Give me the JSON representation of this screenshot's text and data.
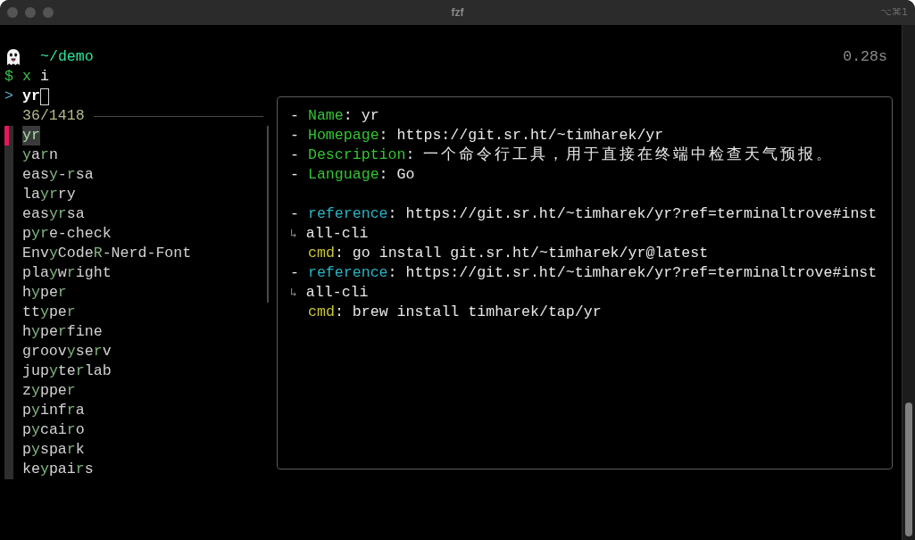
{
  "window": {
    "title": "fzf",
    "shortcut": "⌥⌘1"
  },
  "prompt": {
    "cwd": "~/demo",
    "elapsed": "0.28s"
  },
  "command": {
    "symbol": "$",
    "program": "x",
    "args": "i"
  },
  "query": {
    "marker": ">",
    "value": "yr"
  },
  "counter": "36/1418",
  "results": [
    {
      "selected": true,
      "parts": [
        {
          "text": "yr",
          "match": true
        }
      ]
    },
    {
      "selected": false,
      "parts": [
        {
          "text": "y",
          "match": true
        },
        {
          "text": "a",
          "match": false
        },
        {
          "text": "r",
          "match": true
        },
        {
          "text": "n",
          "match": false
        }
      ]
    },
    {
      "selected": false,
      "parts": [
        {
          "text": "eas",
          "match": false
        },
        {
          "text": "y",
          "match": true
        },
        {
          "text": "-",
          "match": false
        },
        {
          "text": "r",
          "match": true
        },
        {
          "text": "sa",
          "match": false
        }
      ]
    },
    {
      "selected": false,
      "parts": [
        {
          "text": "la",
          "match": false
        },
        {
          "text": "yr",
          "match": true
        },
        {
          "text": "ry",
          "match": false
        }
      ]
    },
    {
      "selected": false,
      "parts": [
        {
          "text": "eas",
          "match": false
        },
        {
          "text": "yr",
          "match": true
        },
        {
          "text": "sa",
          "match": false
        }
      ]
    },
    {
      "selected": false,
      "parts": [
        {
          "text": "p",
          "match": false
        },
        {
          "text": "yr",
          "match": true
        },
        {
          "text": "e-check",
          "match": false
        }
      ]
    },
    {
      "selected": false,
      "parts": [
        {
          "text": "Env",
          "match": false
        },
        {
          "text": "y",
          "match": true
        },
        {
          "text": "Code",
          "match": false
        },
        {
          "text": "R",
          "match": true
        },
        {
          "text": "-Nerd-Font",
          "match": false
        }
      ]
    },
    {
      "selected": false,
      "parts": [
        {
          "text": "pla",
          "match": false
        },
        {
          "text": "y",
          "match": true
        },
        {
          "text": "w",
          "match": false
        },
        {
          "text": "r",
          "match": true
        },
        {
          "text": "ight",
          "match": false
        }
      ]
    },
    {
      "selected": false,
      "parts": [
        {
          "text": "h",
          "match": false
        },
        {
          "text": "y",
          "match": true
        },
        {
          "text": "pe",
          "match": false
        },
        {
          "text": "r",
          "match": true
        }
      ]
    },
    {
      "selected": false,
      "parts": [
        {
          "text": "tt",
          "match": false
        },
        {
          "text": "y",
          "match": true
        },
        {
          "text": "pe",
          "match": false
        },
        {
          "text": "r",
          "match": true
        }
      ]
    },
    {
      "selected": false,
      "parts": [
        {
          "text": "h",
          "match": false
        },
        {
          "text": "y",
          "match": true
        },
        {
          "text": "pe",
          "match": false
        },
        {
          "text": "r",
          "match": true
        },
        {
          "text": "fine",
          "match": false
        }
      ]
    },
    {
      "selected": false,
      "parts": [
        {
          "text": "groov",
          "match": false
        },
        {
          "text": "y",
          "match": true
        },
        {
          "text": "se",
          "match": false
        },
        {
          "text": "r",
          "match": true
        },
        {
          "text": "v",
          "match": false
        }
      ]
    },
    {
      "selected": false,
      "parts": [
        {
          "text": "jup",
          "match": false
        },
        {
          "text": "y",
          "match": true
        },
        {
          "text": "te",
          "match": false
        },
        {
          "text": "r",
          "match": true
        },
        {
          "text": "lab",
          "match": false
        }
      ]
    },
    {
      "selected": false,
      "parts": [
        {
          "text": "z",
          "match": false
        },
        {
          "text": "y",
          "match": true
        },
        {
          "text": "ppe",
          "match": false
        },
        {
          "text": "r",
          "match": true
        }
      ]
    },
    {
      "selected": false,
      "parts": [
        {
          "text": "p",
          "match": false
        },
        {
          "text": "y",
          "match": true
        },
        {
          "text": "inf",
          "match": false
        },
        {
          "text": "r",
          "match": true
        },
        {
          "text": "a",
          "match": false
        }
      ]
    },
    {
      "selected": false,
      "parts": [
        {
          "text": "p",
          "match": false
        },
        {
          "text": "y",
          "match": true
        },
        {
          "text": "cai",
          "match": false
        },
        {
          "text": "r",
          "match": true
        },
        {
          "text": "o",
          "match": false
        }
      ]
    },
    {
      "selected": false,
      "parts": [
        {
          "text": "p",
          "match": false
        },
        {
          "text": "y",
          "match": true
        },
        {
          "text": "spa",
          "match": false
        },
        {
          "text": "r",
          "match": true
        },
        {
          "text": "k",
          "match": false
        }
      ]
    },
    {
      "selected": false,
      "parts": [
        {
          "text": "ke",
          "match": false
        },
        {
          "text": "y",
          "match": true
        },
        {
          "text": "pai",
          "match": false
        },
        {
          "text": "r",
          "match": true
        },
        {
          "text": "s",
          "match": false
        }
      ]
    }
  ],
  "preview": {
    "lines": [
      {
        "kind": "field",
        "bullet": "-",
        "key": "Name",
        "sep": ":",
        "value": "yr"
      },
      {
        "kind": "field",
        "bullet": "-",
        "key": "Homepage",
        "sep": ":",
        "value": "https://git.sr.ht/~timharek/yr"
      },
      {
        "kind": "field",
        "bullet": "-",
        "key": "Description",
        "sep": ":",
        "value": "一个命令行工具，用于直接在终端中检查天气预报。"
      },
      {
        "kind": "field",
        "bullet": "-",
        "key": "Language",
        "sep": ":",
        "value": "Go"
      },
      {
        "kind": "blank"
      },
      {
        "kind": "reference",
        "bullet": "-",
        "key": "reference",
        "sep": ":",
        "value": "https://git.sr.ht/~timharek/yr?ref=terminaltrove#inst"
      },
      {
        "kind": "wrap",
        "marker": "↳",
        "value": "all-cli"
      },
      {
        "kind": "cmd",
        "key": "cmd",
        "sep": ":",
        "value": "go install git.sr.ht/~timharek/yr@latest"
      },
      {
        "kind": "reference",
        "bullet": "-",
        "key": "reference",
        "sep": ":",
        "value": "https://git.sr.ht/~timharek/yr?ref=terminaltrove#inst"
      },
      {
        "kind": "wrap",
        "marker": "↳",
        "value": "all-cli"
      },
      {
        "kind": "cmd",
        "key": "cmd",
        "sep": ":",
        "value": "brew install timharek/tap/yr"
      }
    ]
  }
}
